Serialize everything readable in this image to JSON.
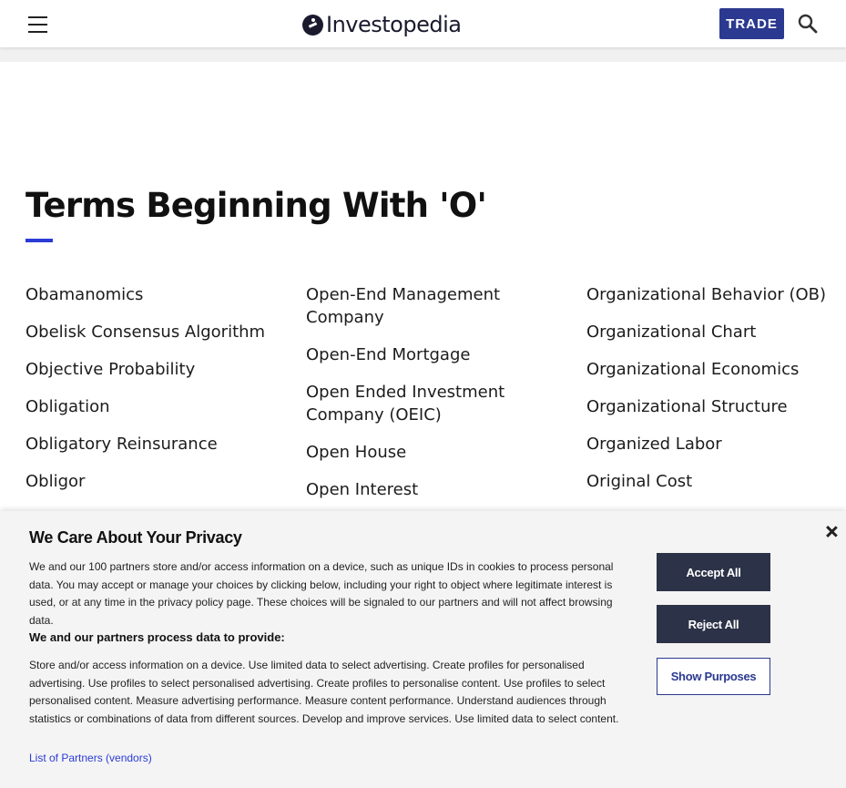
{
  "header": {
    "logo_text": "Investopedia",
    "trade_label": "TRADE",
    "icons": {
      "menu": "hamburger-menu-icon",
      "search": "search-icon"
    }
  },
  "main": {
    "title": "Terms Beginning With 'O'",
    "columns": [
      [
        "Obamanomics",
        "Obelisk Consensus Algorithm",
        "Objective Probability",
        "Obligation",
        "Obligatory Reinsurance",
        "Obligor"
      ],
      [
        "Open-End Management Company",
        "Open-End Mortgage",
        "Open Ended Investment Company (OEIC)",
        "Open House",
        "Open Interest"
      ],
      [
        "Organizational Behavior (OB)",
        "Organizational Chart",
        "Organizational Economics",
        "Organizational Structure",
        "Organized Labor",
        "Original Cost"
      ]
    ]
  },
  "privacy": {
    "title": "We Care About Your Privacy",
    "body": "We and our 100 partners store and/or access information on a device, such as unique IDs in cookies to process personal data. You may accept or manage your choices by clicking below, including your right to object where legitimate interest is used, or at any time in the privacy policy page. These choices will be signaled to our partners and will not affect browsing data.",
    "subhead": "We and our partners process data to provide:",
    "purposes": "Store and/or access information on a device. Use limited data to select advertising. Create profiles for personalised advertising. Use profiles to select personalised advertising. Create profiles to personalise content. Use profiles to select personalised content. Measure advertising performance. Measure content performance. Understand audiences through statistics or combinations of data from different sources. Develop and improve services. Use limited data to select content.",
    "partners_link": "List of Partners (vendors)",
    "accept_label": "Accept All",
    "reject_label": "Reject All",
    "purposes_label": "Show Purposes",
    "close_icon": "close-icon"
  },
  "colors": {
    "brand_navy": "#2b3990",
    "accent_blue": "#2b3bd6",
    "button_dark": "#2c3247",
    "banner_bg": "#f4f4f4"
  }
}
